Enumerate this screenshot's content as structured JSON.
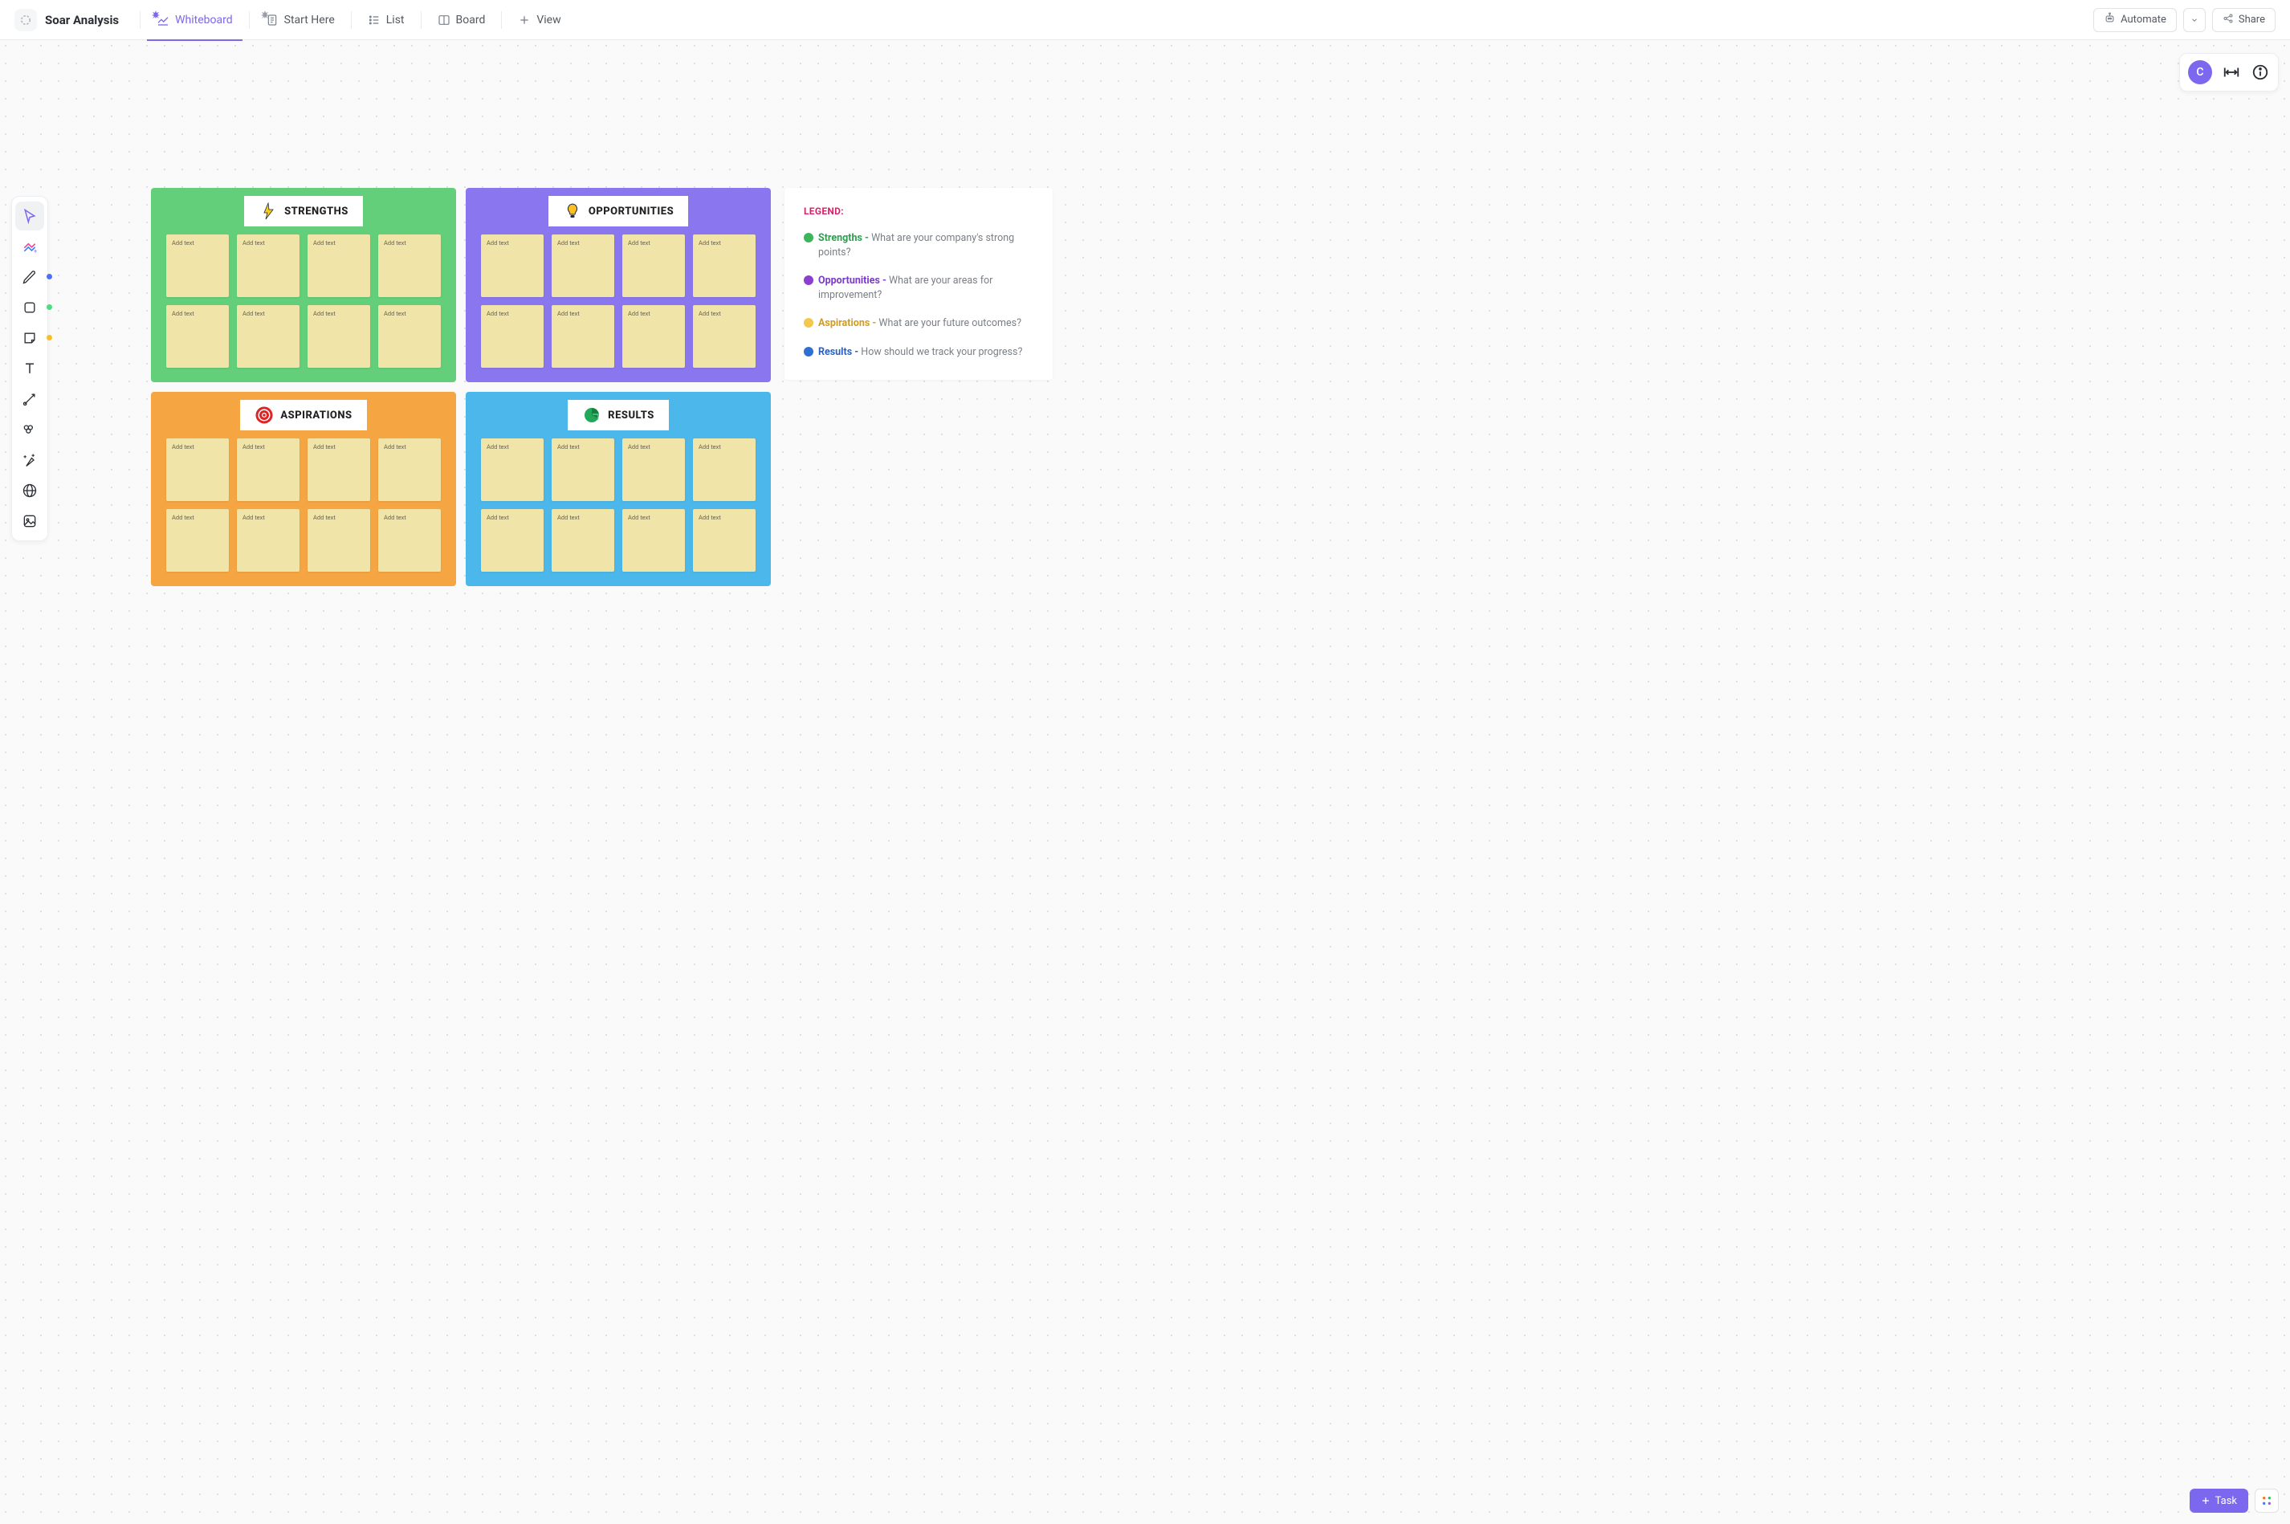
{
  "header": {
    "title": "Soar Analysis",
    "tabs": [
      {
        "id": "whiteboard",
        "label": "Whiteboard",
        "active": true
      },
      {
        "id": "start-here",
        "label": "Start Here",
        "active": false
      },
      {
        "id": "list",
        "label": "List",
        "active": false
      },
      {
        "id": "board",
        "label": "Board",
        "active": false
      }
    ],
    "add_view_label": "View",
    "automate_label": "Automate",
    "share_label": "Share"
  },
  "avatar": {
    "initial": "C"
  },
  "sticky_placeholder": "Add text",
  "quadrants": [
    {
      "id": "strengths",
      "label": "STRENGTHS",
      "css": "q-green"
    },
    {
      "id": "opportunities",
      "label": "OPPORTUNITIES",
      "css": "q-purple"
    },
    {
      "id": "aspirations",
      "label": "ASPIRATIONS",
      "css": "q-orange"
    },
    {
      "id": "results",
      "label": "RESULTS",
      "css": "q-blue"
    }
  ],
  "legend": {
    "title": "LEGEND:",
    "items": [
      {
        "dot": "green",
        "termClass": "c-green",
        "term": "Strengths",
        "desc": "What are your company's strong points?"
      },
      {
        "dot": "purple",
        "termClass": "c-purple",
        "term": "Opportunities",
        "desc": "What are your areas for improvement?"
      },
      {
        "dot": "yellow",
        "termClass": "c-yellow",
        "term": "Aspirations",
        "desc": "What are your future outcomes?"
      },
      {
        "dot": "blue",
        "termClass": "c-blue",
        "term": "Results",
        "desc": "How should we track your progress?"
      }
    ]
  },
  "task_button": "Task"
}
